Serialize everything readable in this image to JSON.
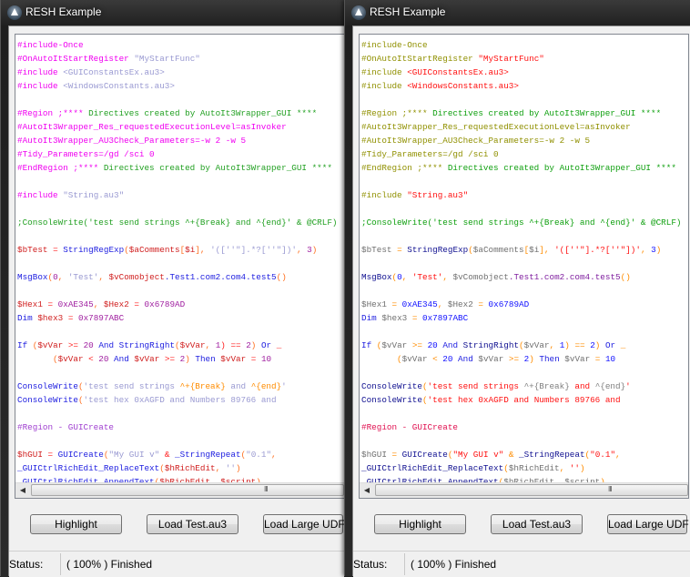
{
  "window_title": "RESH Example",
  "buttons": {
    "highlight": "Highlight",
    "load_test": "Load Test.au3",
    "load_large": "Load Large UDF"
  },
  "status": {
    "label": "Status:",
    "text": "( 100% ) Finished"
  },
  "themes": {
    "left": {
      "dir": "#f000f0",
      "str": "#9a9ad2",
      "com": "#22a022",
      "var": "#d02020",
      "fn": "#2020e0",
      "kw": "#2020e0",
      "op": "#ff2020",
      "num": "#a020a0",
      "br": "#ff7020",
      "send": "#ff8c00",
      "reg": "#a040d0",
      "txt": "#000000",
      "com_obj": "#2020e0"
    },
    "right": {
      "dir": "#909000",
      "str": "#ff1010",
      "com": "#10a010",
      "var": "#707070",
      "fn": "#101090",
      "kw": "#2020e0",
      "op": "#ff8c00",
      "num": "#1010ff",
      "br": "#ff8c00",
      "send": "#808080",
      "reg": "#e01050",
      "txt": "#000000",
      "com_obj": "#8020a0"
    }
  },
  "code_lines": [
    [
      [
        "#include-Once",
        "dir"
      ]
    ],
    [
      [
        "#OnAutoItStartRegister ",
        "dir"
      ],
      [
        "\"MyStartFunc\"",
        "str"
      ]
    ],
    [
      [
        "#include ",
        "dir"
      ],
      [
        "<GUIConstantsEx.au3>",
        "str"
      ]
    ],
    [
      [
        "#include ",
        "dir"
      ],
      [
        "<WindowsConstants.au3>",
        "str"
      ]
    ],
    [],
    [
      [
        "#Region ;**** ",
        "dir"
      ],
      [
        "Directives created by AutoIt3Wrapper_GUI ****",
        "com"
      ]
    ],
    [
      [
        "#AutoIt3Wrapper_Res_requestedExecutionLevel=asInvoker",
        "dir"
      ]
    ],
    [
      [
        "#AutoIt3Wrapper_AU3Check_Parameters=-w 2 -w 5",
        "dir"
      ]
    ],
    [
      [
        "#Tidy_Parameters=/gd /sci 0",
        "dir"
      ]
    ],
    [
      [
        "#EndRegion ;**** ",
        "dir"
      ],
      [
        "Directives created by AutoIt3Wrapper_GUI ****",
        "com"
      ]
    ],
    [],
    [
      [
        "#include ",
        "dir"
      ],
      [
        "\"String.au3\"",
        "str"
      ]
    ],
    [],
    [
      [
        ";ConsoleWrite('test send strings ^+{Break} and ^{end}' & @CRLF)",
        "com"
      ]
    ],
    [],
    [
      [
        "$bTest",
        "var"
      ],
      [
        " = ",
        "op"
      ],
      [
        "StringRegExp",
        "fn"
      ],
      [
        "(",
        "br"
      ],
      [
        "$aComments",
        "var"
      ],
      [
        "[",
        "br"
      ],
      [
        "$i",
        "var"
      ],
      [
        "], ",
        "br"
      ],
      [
        "'([''\"].*?[''\"])'",
        "str"
      ],
      [
        ", ",
        "br"
      ],
      [
        "3",
        "num"
      ],
      [
        ")",
        "br"
      ]
    ],
    [],
    [
      [
        "MsgBox",
        "fn"
      ],
      [
        "(",
        "br"
      ],
      [
        "0",
        "num"
      ],
      [
        ", ",
        "br"
      ],
      [
        "'Test'",
        "str"
      ],
      [
        ", ",
        "br"
      ],
      [
        "$vComobject",
        "var"
      ],
      [
        ".Test1.com2.com4.test5",
        "com_obj"
      ],
      [
        "()",
        "br"
      ]
    ],
    [],
    [
      [
        "$Hex1",
        "var"
      ],
      [
        " = ",
        "op"
      ],
      [
        "0xAE345",
        "num"
      ],
      [
        ", ",
        "br"
      ],
      [
        "$Hex2",
        "var"
      ],
      [
        " = ",
        "op"
      ],
      [
        "0x6789AD",
        "num"
      ]
    ],
    [
      [
        "Dim ",
        "kw"
      ],
      [
        "$hex3",
        "var"
      ],
      [
        " = ",
        "op"
      ],
      [
        "0x7897ABC",
        "num"
      ]
    ],
    [],
    [
      [
        "If ",
        "kw"
      ],
      [
        "(",
        "br"
      ],
      [
        "$vVar",
        "var"
      ],
      [
        " >= ",
        "op"
      ],
      [
        "20",
        "num"
      ],
      [
        " And ",
        "kw"
      ],
      [
        "StringRight",
        "fn"
      ],
      [
        "(",
        "br"
      ],
      [
        "$vVar",
        "var"
      ],
      [
        ", ",
        "br"
      ],
      [
        "1",
        "num"
      ],
      [
        ") == ",
        "op"
      ],
      [
        "2",
        "num"
      ],
      [
        ") ",
        "br"
      ],
      [
        "Or ",
        "kw"
      ],
      [
        "_",
        "op"
      ]
    ],
    [
      [
        "       (",
        "br"
      ],
      [
        "$vVar",
        "var"
      ],
      [
        " < ",
        "op"
      ],
      [
        "20",
        "num"
      ],
      [
        " And ",
        "kw"
      ],
      [
        "$vVar",
        "var"
      ],
      [
        " >= ",
        "op"
      ],
      [
        "2",
        "num"
      ],
      [
        ") ",
        "br"
      ],
      [
        "Then ",
        "kw"
      ],
      [
        "$vVar",
        "var"
      ],
      [
        " = ",
        "op"
      ],
      [
        "10",
        "num"
      ]
    ],
    [],
    [
      [
        "ConsoleWrite",
        "fn"
      ],
      [
        "(",
        "br"
      ],
      [
        "'test send strings ",
        "str"
      ],
      [
        "^+{Break}",
        "send"
      ],
      [
        " and ",
        "str"
      ],
      [
        "^{end}",
        "send"
      ],
      [
        "'",
        "str"
      ]
    ],
    [
      [
        "ConsoleWrite",
        "fn"
      ],
      [
        "(",
        "br"
      ],
      [
        "'test hex 0xAGFD and Numbers 89766 and",
        "str"
      ]
    ],
    [],
    [
      [
        "#Region - GUICreate",
        "reg"
      ]
    ],
    [],
    [
      [
        "$hGUI",
        "var"
      ],
      [
        " = ",
        "op"
      ],
      [
        "GUICreate",
        "fn"
      ],
      [
        "(",
        "br"
      ],
      [
        "\"My GUI v\"",
        "str"
      ],
      [
        " & ",
        "op"
      ],
      [
        "_StringRepeat",
        "fn"
      ],
      [
        "(",
        "br"
      ],
      [
        "\"0.1\"",
        "str"
      ],
      [
        ", ",
        "br"
      ]
    ],
    [
      [
        "_GUICtrlRichEdit_ReplaceText",
        "fn"
      ],
      [
        "(",
        "br"
      ],
      [
        "$hRichEdit",
        "var"
      ],
      [
        ", ",
        "br"
      ],
      [
        "''",
        "str"
      ],
      [
        ")",
        "br"
      ]
    ],
    [
      [
        "_GUICtrlRichEdit_AppendText",
        "fn"
      ],
      [
        "(",
        "br"
      ],
      [
        "$hRichEdit",
        "var"
      ],
      [
        ", ",
        "br"
      ],
      [
        "$script",
        "var"
      ],
      [
        ")",
        "br"
      ]
    ]
  ]
}
